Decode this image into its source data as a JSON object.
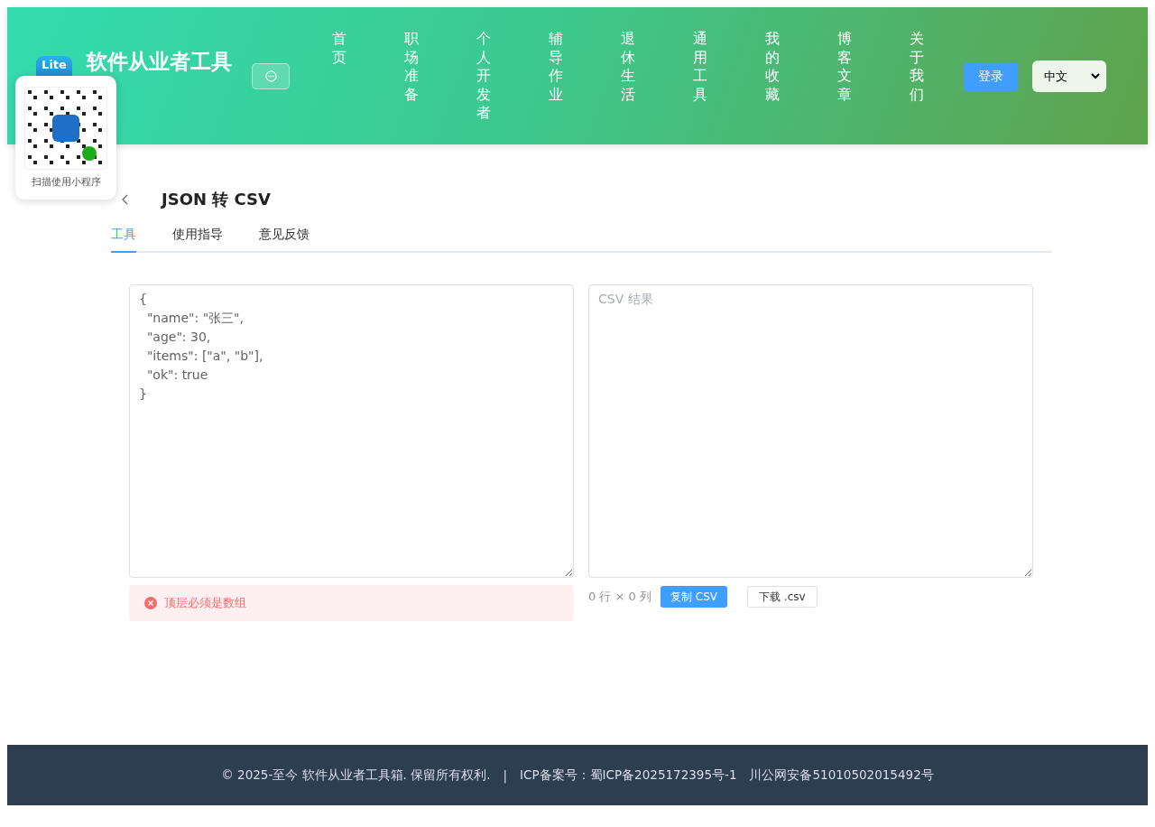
{
  "header": {
    "logo_text": "Lite",
    "site_title": "软件从业者工具",
    "nav": [
      {
        "label": "首页"
      },
      {
        "label": "职场准备"
      },
      {
        "label": "个人开发者"
      },
      {
        "label": "辅导作业"
      },
      {
        "label": "退休生活"
      },
      {
        "label": "通用工具"
      },
      {
        "label": "我的收藏"
      },
      {
        "label": "博客文章"
      },
      {
        "label": "关于我们"
      }
    ],
    "login_button": "登录",
    "language": "中文"
  },
  "qr_popup": {
    "caption": "扫描使用小程序"
  },
  "page": {
    "title": "JSON 转 CSV",
    "tabs": [
      {
        "label": "工具",
        "selected": true
      },
      {
        "label": "使用指导",
        "selected": false
      },
      {
        "label": "意见反馈",
        "selected": false
      }
    ]
  },
  "input": {
    "value": "{\n  \"name\": \"张三\",\n  \"age\": 30,\n  \"items\": [\"a\", \"b\"],\n  \"ok\": true\n}"
  },
  "error": {
    "message": "顶层必须是数组"
  },
  "output": {
    "placeholder": "CSV 结果",
    "stats": "0 行 × 0 列",
    "copy_button": "复制 CSV",
    "download_button": "下载 .csv"
  },
  "footer": {
    "copyright": "© 2025-至今 软件从业者工具箱. 保留所有权利.",
    "separator": "|",
    "icp": "ICP备案号：蜀ICP备2025172395号-1",
    "police": "川公网安备51010502015492号"
  }
}
